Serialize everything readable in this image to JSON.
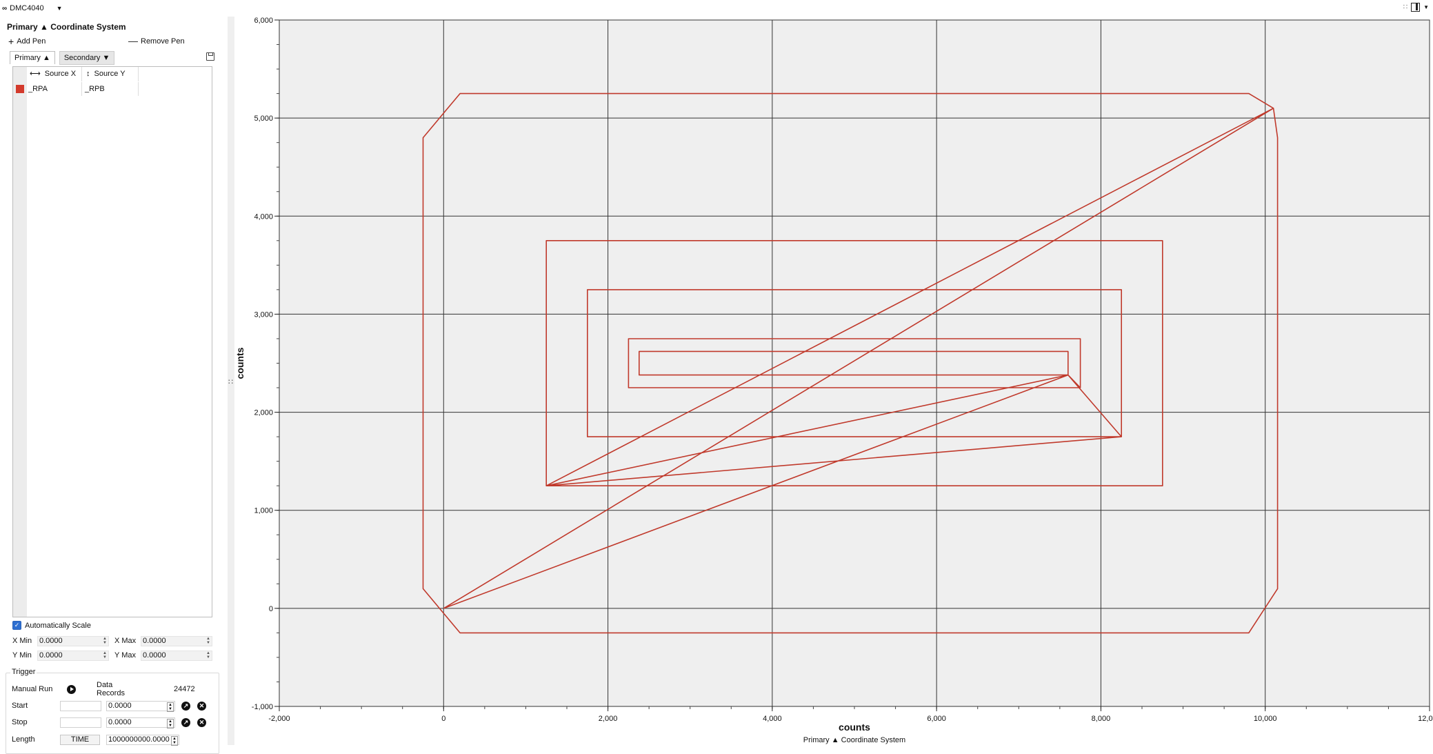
{
  "topbar": {
    "device": "DMC4040"
  },
  "panel": {
    "title": "Primary ▲ Coordinate System",
    "add_pen": "Add Pen",
    "remove_pen": "Remove Pen",
    "tabs": [
      {
        "label": "Primary ▲",
        "active": true
      },
      {
        "label": "Secondary ▼",
        "active": false
      }
    ],
    "columns": {
      "x": "Source X",
      "y": "Source Y"
    },
    "pens": [
      {
        "color": "#d33a2c",
        "x": "_RPA",
        "y": "_RPB"
      }
    ],
    "auto_scale": {
      "label": "Automatically Scale",
      "checked": true
    },
    "ranges": {
      "xmin_label": "X Min",
      "xmin": "0.0000",
      "xmax_label": "X Max",
      "xmax": "0.0000",
      "ymin_label": "Y Min",
      "ymin": "0.0000",
      "ymax_label": "Y Max",
      "ymax": "0.0000"
    }
  },
  "trigger": {
    "title": "Trigger",
    "manual_run": "Manual Run",
    "records_label": "Data Records",
    "records": "24472",
    "start_label": "Start",
    "start_value": "0.0000",
    "stop_label": "Stop",
    "stop_value": "0.0000",
    "length_label": "Length",
    "length_mode": "TIME",
    "length_value": "1000000000.0000"
  },
  "chart_data": {
    "type": "line",
    "title": "",
    "subtitle": "Primary ▲ Coordinate System",
    "xlabel": "counts",
    "ylabel": "counts",
    "xlim": [
      -2000,
      12000
    ],
    "ylim": [
      -1000,
      6000
    ],
    "x_ticks": [
      "-2,000",
      "0",
      "2,000",
      "4,000",
      "6,000",
      "8,000",
      "10,000",
      "12,000"
    ],
    "y_ticks": [
      "-1,000",
      "0",
      "1,000",
      "2,000",
      "3,000",
      "4,000",
      "5,000",
      "6,000"
    ],
    "grid": true,
    "background": "#efefef",
    "series": [
      {
        "color": "#c0392b",
        "points": [
          [
            0,
            0
          ],
          [
            10100,
            5100
          ],
          [
            9800,
            5250
          ],
          [
            200,
            5250
          ],
          [
            -250,
            4800
          ],
          [
            -250,
            200
          ],
          [
            200,
            -250
          ],
          [
            9800,
            -250
          ],
          [
            10150,
            200
          ],
          [
            10150,
            4800
          ],
          [
            10100,
            5100
          ],
          [
            1250,
            1250
          ],
          [
            8750,
            1250
          ],
          [
            8750,
            3750
          ],
          [
            1250,
            3750
          ],
          [
            1250,
            1250
          ],
          [
            8250,
            1750
          ],
          [
            8250,
            3250
          ],
          [
            1750,
            3250
          ],
          [
            1750,
            1750
          ],
          [
            8250,
            1750
          ],
          [
            7600,
            2380
          ],
          [
            7750,
            2250
          ],
          [
            2250,
            2250
          ],
          [
            2250,
            2750
          ],
          [
            7750,
            2750
          ],
          [
            7750,
            2250
          ],
          [
            7600,
            2380
          ],
          [
            2380,
            2380
          ],
          [
            2380,
            2620
          ],
          [
            7600,
            2620
          ],
          [
            7600,
            2380
          ],
          [
            1250,
            1250
          ],
          [
            7600,
            2380
          ],
          [
            0,
            0
          ]
        ]
      }
    ]
  }
}
